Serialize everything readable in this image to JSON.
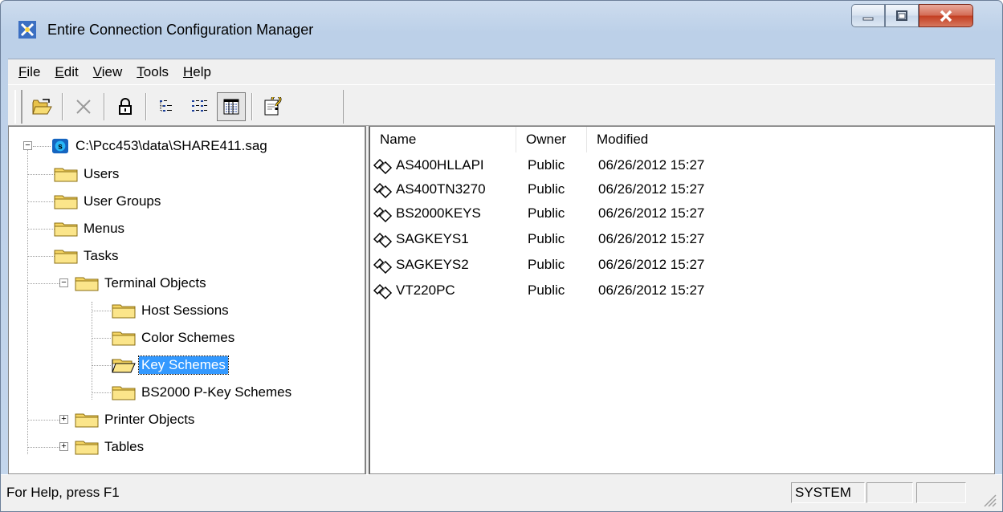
{
  "window": {
    "title": "Entire Connection Configuration Manager"
  },
  "menu": {
    "items": [
      {
        "label": "File",
        "accel": "F",
        "rest": "ile"
      },
      {
        "label": "Edit",
        "accel": "E",
        "rest": "dit"
      },
      {
        "label": "View",
        "accel": "V",
        "rest": "iew"
      },
      {
        "label": "Tools",
        "accel": "T",
        "rest": "ools"
      },
      {
        "label": "Help",
        "accel": "H",
        "rest": "elp"
      }
    ]
  },
  "toolbar": {
    "buttons": [
      {
        "icon": "open-folder-icon"
      },
      {
        "icon": "delete-x-icon"
      },
      {
        "icon": "lock-icon"
      },
      {
        "icon": "large-icons-icon"
      },
      {
        "icon": "list-view-icon"
      },
      {
        "icon": "details-view-icon",
        "pressed": true
      },
      {
        "icon": "help-icon"
      }
    ]
  },
  "tree": {
    "root": "C:\\Pcc453\\data\\SHARE411.sag",
    "users": "Users",
    "user_groups": "User Groups",
    "menus": "Menus",
    "tasks": "Tasks",
    "terminal_objects": "Terminal Objects",
    "host_sessions": "Host Sessions",
    "color_schemes": "Color Schemes",
    "key_schemes": "Key Schemes",
    "bs2000_pkey": "BS2000 P-Key Schemes",
    "printer_objects": "Printer Objects",
    "tables": "Tables"
  },
  "list": {
    "columns": {
      "name": "Name",
      "owner": "Owner",
      "modified": "Modified"
    },
    "rows": [
      {
        "name": "AS400HLLAPI",
        "owner": "Public",
        "modified": "06/26/2012 15:27"
      },
      {
        "name": "AS400TN3270",
        "owner": "Public",
        "modified": "06/26/2012 15:27"
      },
      {
        "name": "BS2000KEYS",
        "owner": "Public",
        "modified": "06/26/2012 15:27"
      },
      {
        "name": "SAGKEYS1",
        "owner": "Public",
        "modified": "06/26/2012 15:27"
      },
      {
        "name": "SAGKEYS2",
        "owner": "Public",
        "modified": "06/26/2012 15:27"
      },
      {
        "name": "VT220PC",
        "owner": "Public",
        "modified": "06/26/2012 15:27"
      }
    ]
  },
  "status": {
    "help_text": "For Help, press F1",
    "user": "SYSTEM",
    "panel2": "",
    "panel3": ""
  },
  "colors": {
    "selection": "#3399ff",
    "folder": "#f5d563",
    "close_button": "#c33d20"
  }
}
